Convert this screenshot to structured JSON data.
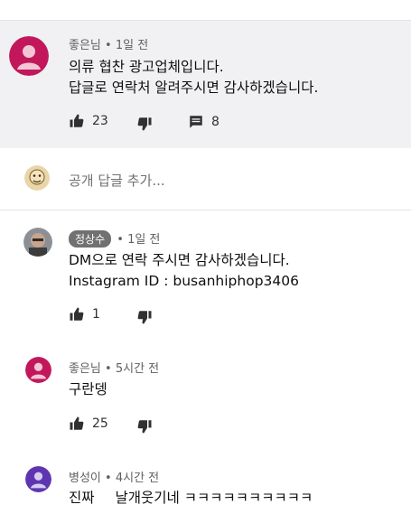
{
  "colors": {
    "highlight_bg": "#f1f1f3",
    "avatar_pink": "#c2185b",
    "avatar_purple": "#5e35b1",
    "chip_bg": "#717171"
  },
  "comment1": {
    "author": "좋은님",
    "time": "• 1일 전",
    "line1": "의류 협찬 광고업체입니다.",
    "line2": "답글로 연락처 알려주시면 감사하겠습니다.",
    "likes": "23",
    "replies": "8",
    "avatar_icon": "person-icon"
  },
  "reply_input": {
    "placeholder": "공개 답글 추가..."
  },
  "comment2": {
    "author": "정상수",
    "time": "• 1일 전",
    "line1": "DM으로 연락 주시면 감사하겠습니다.",
    "line2": "Instagram ID : busanhiphop3406",
    "likes": "1"
  },
  "comment3": {
    "author": "좋은님",
    "time": "• 5시간 전",
    "line1": "구란뎅",
    "likes": "25"
  },
  "comment4": {
    "author": "병성이",
    "time": "• 4시간 전",
    "line1_a": "진짜",
    "line1_b": "날개웃기네 ㅋㅋㅋㅋㅋㅋㅋㅋㅋㅋ"
  }
}
